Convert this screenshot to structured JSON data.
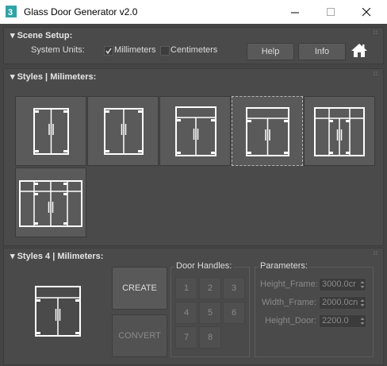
{
  "window": {
    "title": "Glass Door Generator v2.0"
  },
  "scene_setup": {
    "header": "Scene Setup:",
    "system_units_label": "System Units:",
    "millimeters_label": "Millimeters",
    "millimeters_checked": true,
    "centimeters_label": "Centimeters",
    "centimeters_checked": false,
    "help_label": "Help",
    "info_label": "Info"
  },
  "styles": {
    "header": "Styles | Milimeters:",
    "selected_index": 4
  },
  "current": {
    "header": "Styles 4 | Milimeters:",
    "create_label": "CREATE",
    "convert_label": "CONVERT",
    "door_handles": {
      "title": "Door Handles:",
      "buttons": [
        "1",
        "2",
        "3",
        "4",
        "5",
        "6",
        "7",
        "8"
      ]
    },
    "parameters": {
      "title": "Parameters:",
      "height_frame_label": "Height_Frame:",
      "height_frame_value": "3000.0cr",
      "width_frame_label": "Width_Frame:",
      "width_frame_value": "2000.0cn",
      "height_door_label": "Height_Door:",
      "height_door_value": "2200.0"
    }
  }
}
